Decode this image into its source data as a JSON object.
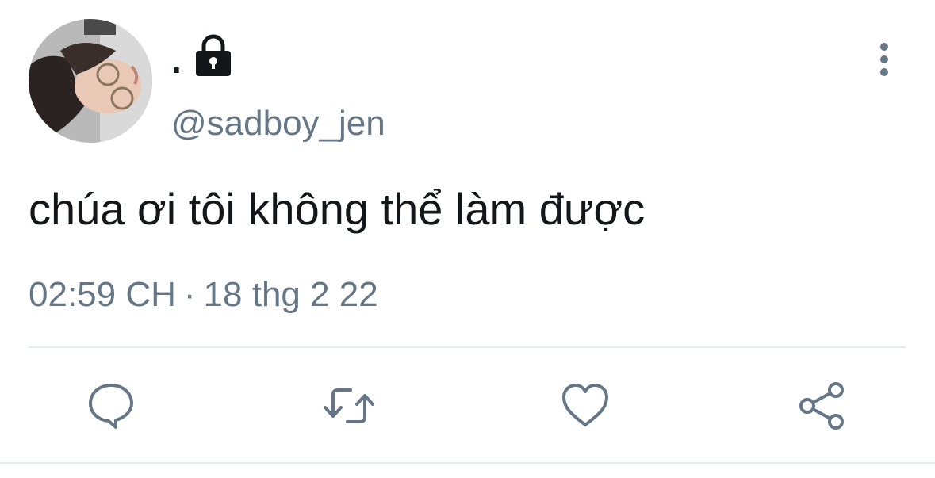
{
  "tweet": {
    "display_name": ".",
    "handle": "@sadboy_jen",
    "text": "chúa ơi tôi không thể làm được",
    "time": "02:59 CH",
    "separator": "·",
    "date": "18 thg 2 22",
    "protected": true
  },
  "icons": {
    "lock": "lock-icon",
    "more": "more-vertical-icon",
    "reply": "reply-icon",
    "retweet": "retweet-icon",
    "like": "heart-icon",
    "share": "share-icon"
  },
  "colors": {
    "text": "#14171a",
    "secondary": "#657786",
    "divider": "#e6ecf0",
    "icon": "#657786"
  }
}
